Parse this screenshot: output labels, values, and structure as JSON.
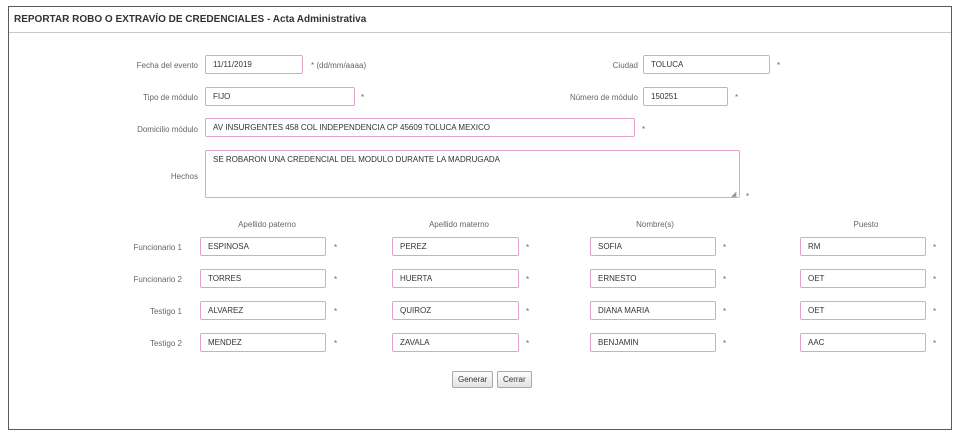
{
  "header": {
    "title": "REPORTAR ROBO O EXTRAVÍO DE CREDENCIALES - Acta Administrativa"
  },
  "form": {
    "fecha": {
      "label": "Fecha del evento",
      "value": "11/11/2019",
      "hint": "* (dd/mm/aaaa)"
    },
    "ciudad": {
      "label": "Ciudad",
      "value": "TOLUCA"
    },
    "tipo_modulo": {
      "label": "Tipo de módulo",
      "value": "FIJO"
    },
    "numero_modulo": {
      "label": "Número de módulo",
      "value": "150251"
    },
    "domicilio": {
      "label": "Domicilio módulo",
      "value": "AV INSURGENTES 458 COL INDEPENDENCIA CP 45609 TOLUCA MEXICO"
    },
    "hechos": {
      "label": "Hechos",
      "value": "SE ROBARON UNA CREDENCIAL DEL MODULO DURANTE LA MADRUGADA"
    },
    "required_mark": "*"
  },
  "people": {
    "columns": [
      "Apellido paterno",
      "Apellido materno",
      "Nombre(s)",
      "Puesto"
    ],
    "rows": [
      {
        "label": "Funcionario 1",
        "values": [
          "ESPINOSA",
          "PEREZ",
          "SOFIA",
          "RM"
        ]
      },
      {
        "label": "Funcionario 2",
        "values": [
          "TORRES",
          "HUERTA",
          "ERNESTO",
          "OET"
        ]
      },
      {
        "label": "Testigo 1",
        "values": [
          "ALVAREZ",
          "QUIROZ",
          "DIANA MARIA",
          "OET"
        ]
      },
      {
        "label": "Testigo 2",
        "values": [
          "MENDEZ",
          "ZAVALA",
          "BENJAMIN",
          "AAC"
        ]
      }
    ]
  },
  "buttons": {
    "generate": "Generar",
    "close": "Cerrar"
  }
}
